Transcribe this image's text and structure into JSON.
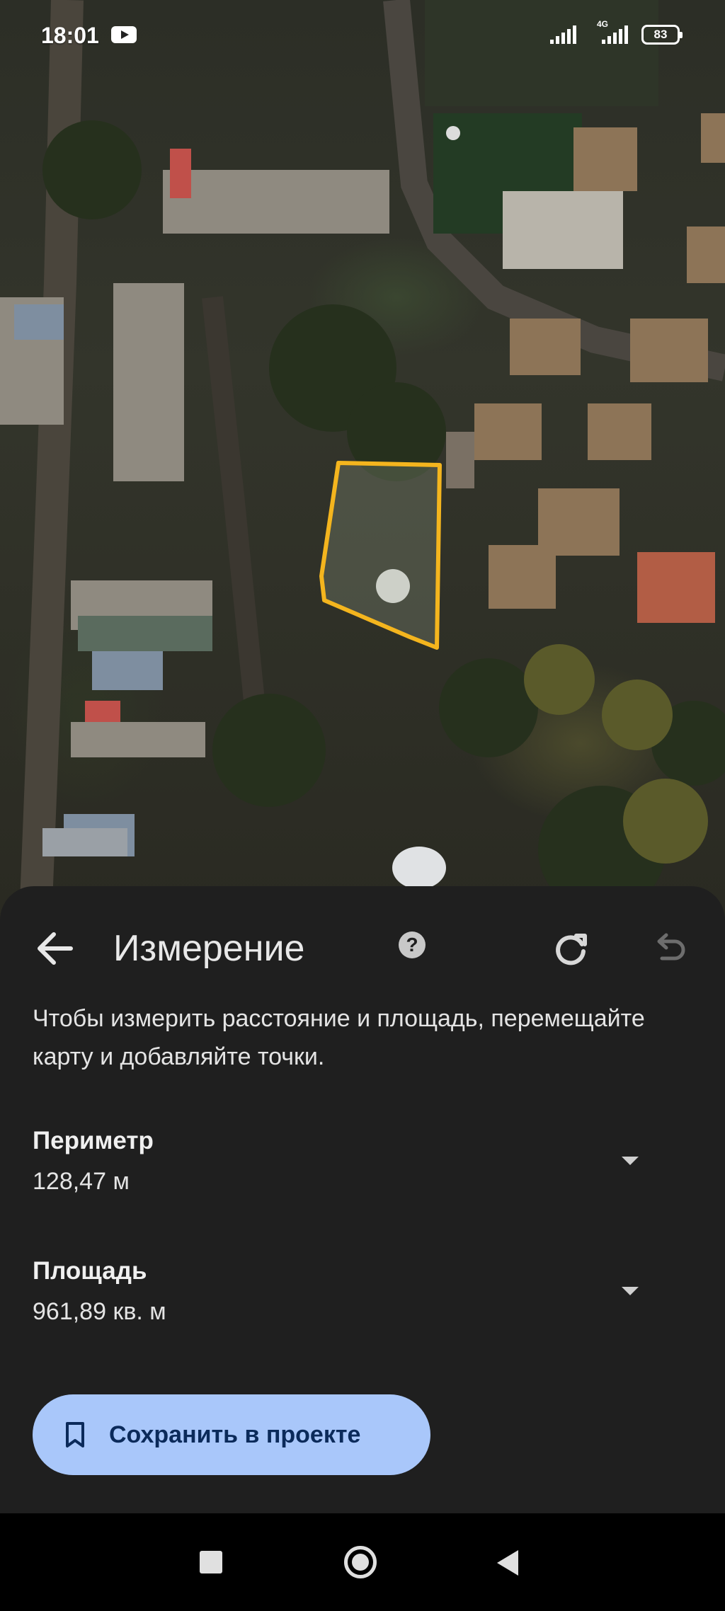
{
  "status_bar": {
    "time": "18:01",
    "network_label": "4G",
    "battery": "83",
    "icons": [
      "youtube-icon",
      "signal-icon",
      "signal-4g-icon",
      "battery-icon"
    ]
  },
  "sheet": {
    "title": "Измерение",
    "instructions": "Чтобы измерить расстояние и площадь, перемещайте карту и добавляйте точки.",
    "perimeter": {
      "label": "Периметр",
      "value": "128,47 м"
    },
    "area": {
      "label": "Площадь",
      "value": "961,89 кв. м"
    },
    "save_button_label": "Сохранить в проекте",
    "icons": [
      "back-arrow-icon",
      "help-icon",
      "redo-icon",
      "undo-icon",
      "chevron-down-icon",
      "bookmark-icon"
    ]
  },
  "colors": {
    "sheet_bg": "#1f1f1f",
    "measure_outline": "#f4b51e",
    "save_button_bg": "#a9c7fa",
    "save_button_text": "#0b2a5a"
  },
  "nav_bar": {
    "icons": [
      "recent-apps-icon",
      "home-icon",
      "back-triangle-icon"
    ]
  }
}
